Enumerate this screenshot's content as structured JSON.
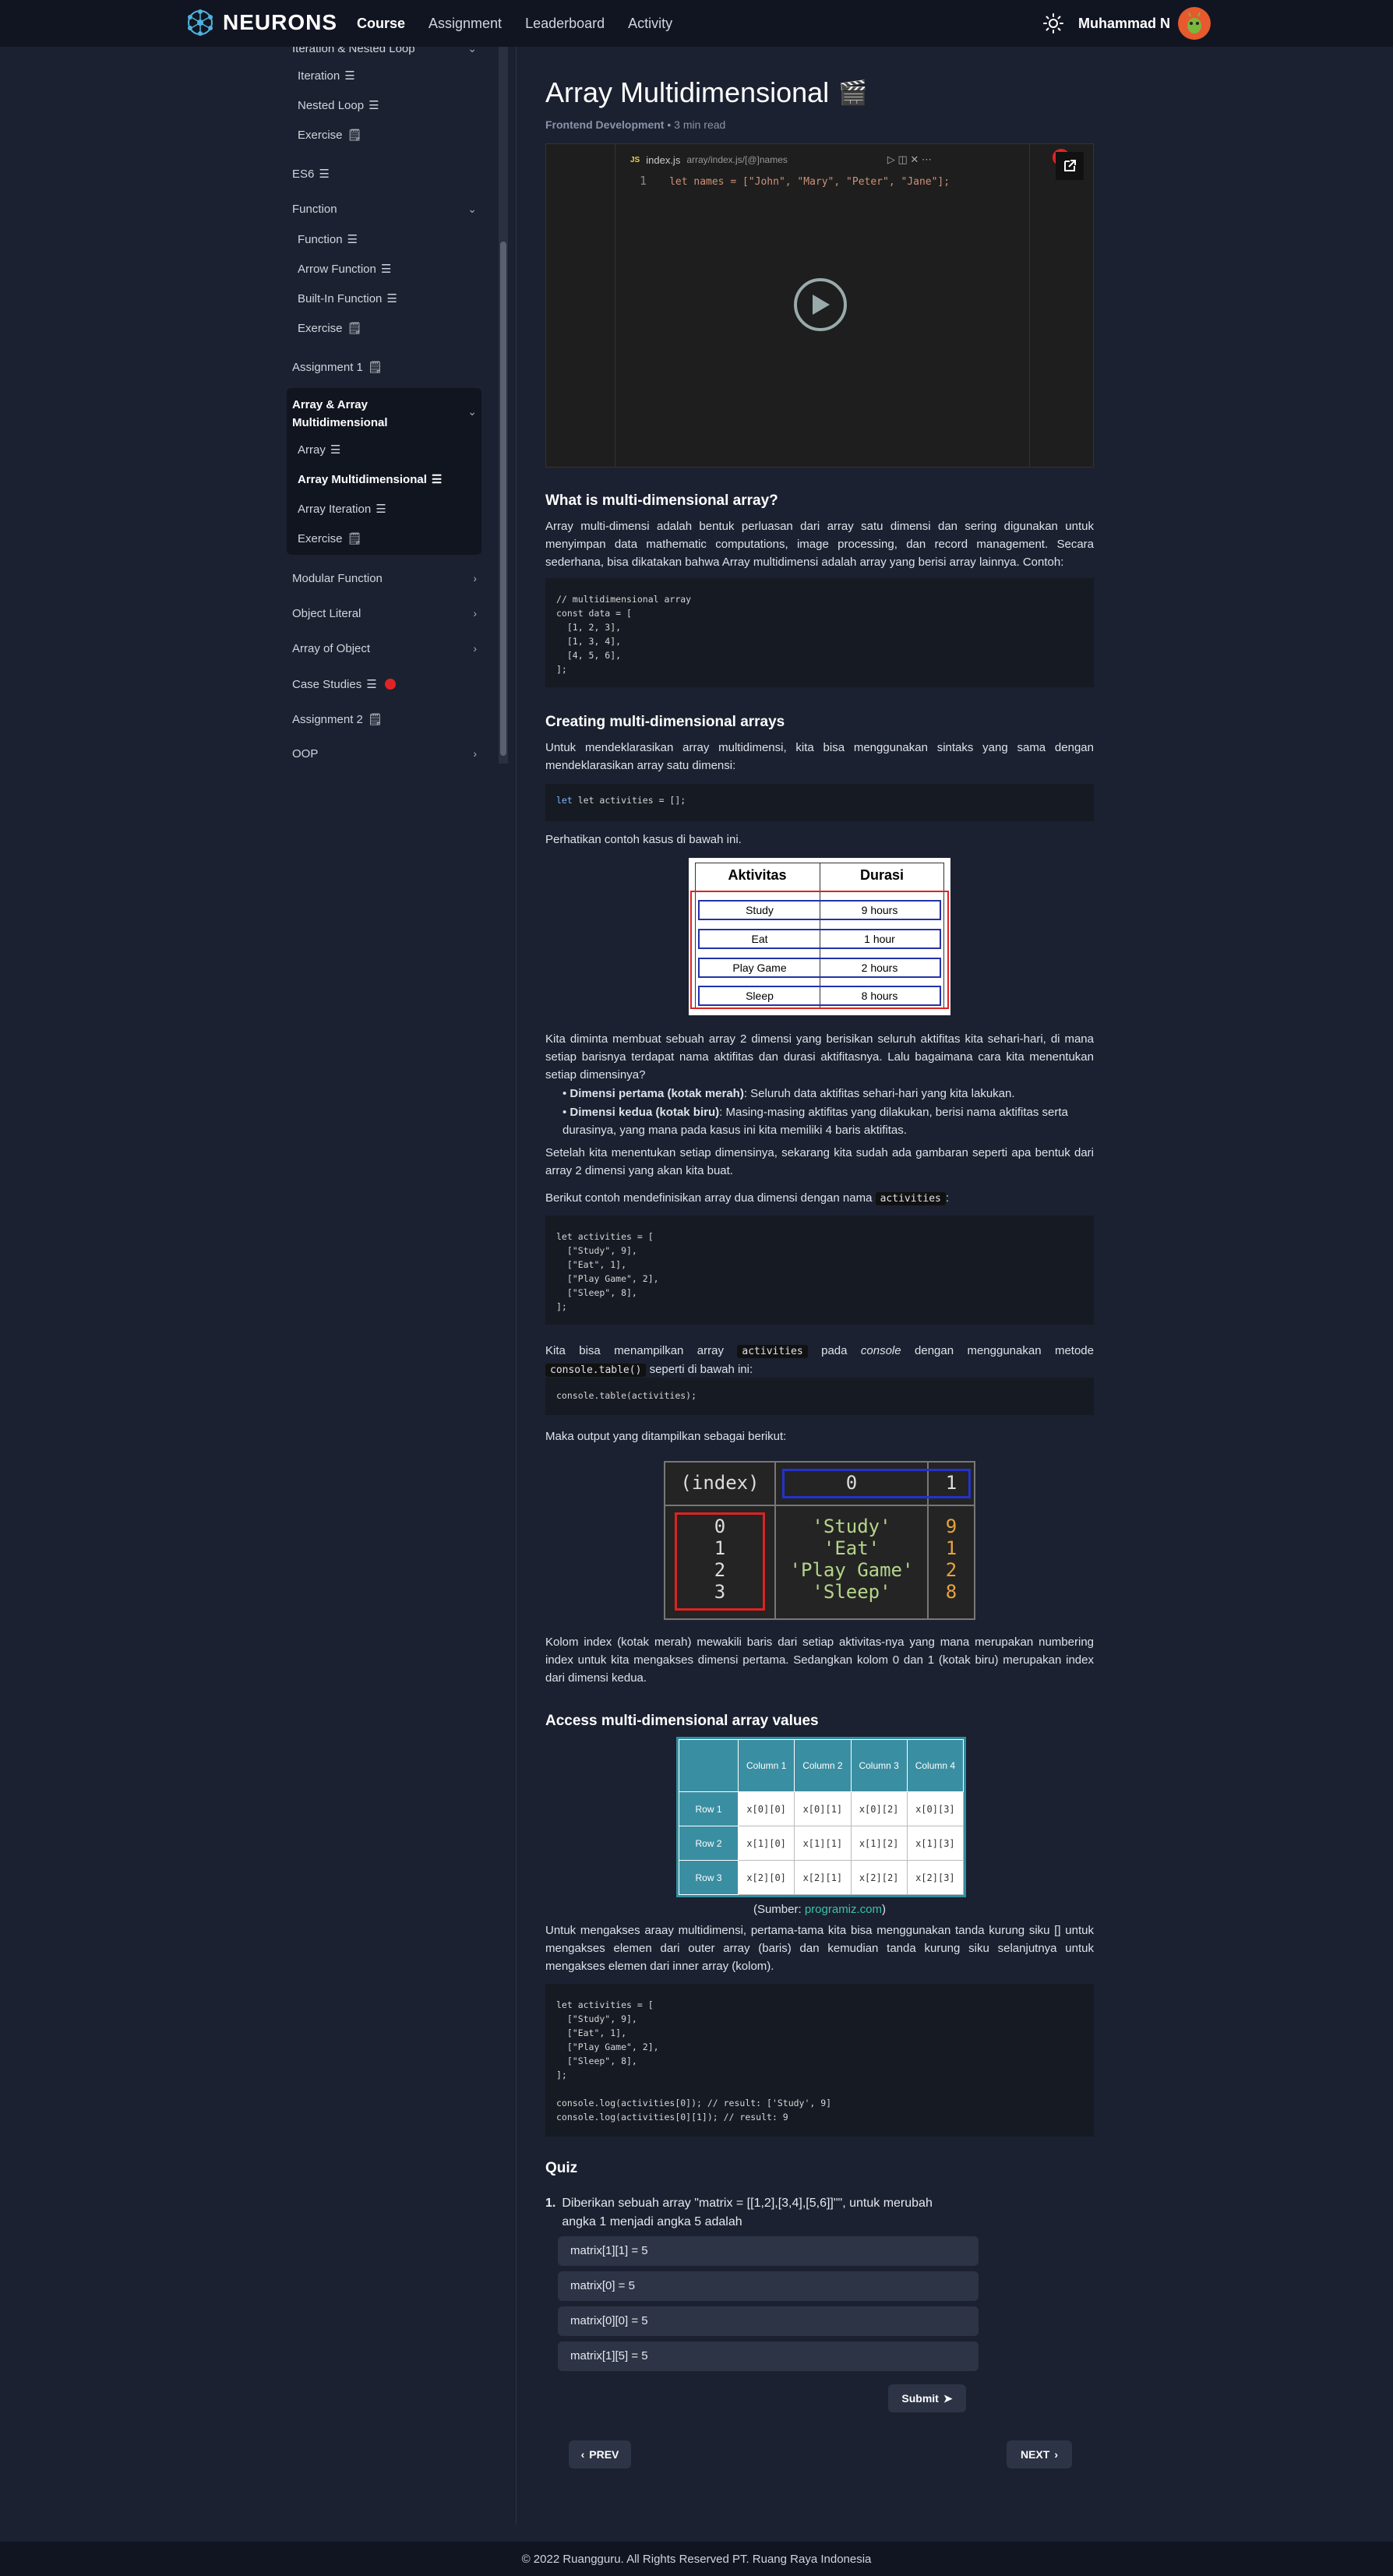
{
  "app": {
    "brand": "NEURONS",
    "user": "Muhammad N"
  },
  "nav": {
    "items": [
      "Course",
      "Assignment",
      "Leaderboard",
      "Activity"
    ],
    "active": "Course"
  },
  "sidebar": {
    "items": [
      {
        "label": "Iteration & Nested Loop",
        "type": "group"
      },
      {
        "label": "Iteration",
        "type": "sub"
      },
      {
        "label": "Nested Loop",
        "type": "sub"
      },
      {
        "label": "Exercise",
        "type": "sub"
      },
      {
        "label": "ES6",
        "type": "item"
      },
      {
        "label": "Function",
        "type": "group"
      },
      {
        "label": "Function",
        "type": "sub"
      },
      {
        "label": "Arrow Function",
        "type": "sub"
      },
      {
        "label": "Built-In Function",
        "type": "sub"
      },
      {
        "label": "Exercise",
        "type": "sub"
      },
      {
        "label": "Assignment 1",
        "type": "item"
      },
      {
        "label": "Array & Array Multidimensional",
        "type": "group"
      },
      {
        "label": "Array",
        "type": "sub"
      },
      {
        "label": "Array Multidimensional",
        "type": "sub-active"
      },
      {
        "label": "Array Iteration",
        "type": "sub"
      },
      {
        "label": "Exercise",
        "type": "sub"
      },
      {
        "label": "Modular Function",
        "type": "group"
      },
      {
        "label": "Object Literal",
        "type": "group"
      },
      {
        "label": "Array of Object",
        "type": "group"
      },
      {
        "label": "Case Studies",
        "type": "item"
      },
      {
        "label": "Assignment 2",
        "type": "item"
      },
      {
        "label": "OOP",
        "type": "group"
      }
    ]
  },
  "article": {
    "title": "Array Multidimensional",
    "category": "Frontend Development",
    "read_time": "3 min read",
    "video": {
      "file_tab": "index.js",
      "path": "array/index.js/[@]names",
      "line_no": "1",
      "code": "let names = [\"John\", \"Mary\", \"Peter\", \"Jane\"];"
    },
    "h1": "What is multi-dimensional array?",
    "p1": "Array multi-dimensi adalah bentuk perluasan dari array satu dimensi dan sering digunakan untuk menyimpan data mathematic computations, image processing, dan record management. Secara sederhana, bisa dikatakan bahwa Array multidimensi adalah array yang berisi array lainnya. Contoh:",
    "code1": "// multidimensional array\nconst data = [\n  [1, 2, 3],\n  [1, 3, 4],\n  [4, 5, 6],\n];",
    "h2": "Creating multi-dimensional arrays",
    "p2": "Untuk mendeklarasikan array multidimensi, kita bisa menggunakan sintaks yang sama dengan mendeklarasikan array satu dimensi:",
    "code2": "let activities = [];",
    "p3": "Perhatikan contoh kasus di bawah ini.",
    "table_img": {
      "headers": [
        "Aktivitas",
        "Durasi"
      ],
      "rows": [
        [
          "Study",
          "9 hours"
        ],
        [
          "Eat",
          "1 hour"
        ],
        [
          "Play Game",
          "2 hours"
        ],
        [
          "Sleep",
          "8 hours"
        ]
      ]
    },
    "p4": "Kita diminta membuat sebuah array 2 dimensi yang berisikan seluruh aktifitas kita sehari-hari, di mana setiap barisnya terdapat nama aktifitas dan durasi aktifitasnya. Lalu bagaimana cara kita menentukan setiap dimensinya?",
    "b1_strong": "Dimensi pertama (kotak merah)",
    "b1_text": ": Seluruh data aktifitas sehari-hari yang kita lakukan.",
    "b2_strong": "Dimensi kedua (kotak biru)",
    "b2_text": ": Masing-masing aktifitas yang dilakukan, berisi nama aktifitas serta durasinya, yang mana pada kasus ini kita memiliki 4 baris aktifitas.",
    "p5": "Setelah kita menentukan setiap dimensinya, sekarang kita sudah ada gambaran seperti apa bentuk dari array 2 dimensi yang akan kita buat.",
    "p6_pre": "Berikut contoh mendefinisikan array dua dimensi dengan nama ",
    "p6_code": "activities",
    "p6_post": ":",
    "code3": "let activities = [\n  [\"Study\", 9],\n  [\"Eat\", 1],\n  [\"Play Game\", 2],\n  [\"Sleep\", 8],\n];",
    "p7_a": "Kita bisa menampilkan array ",
    "p7_code1": "activities",
    "p7_b": " pada ",
    "p7_em": "console",
    "p7_c": " dengan menggunakan metode ",
    "p7_code2": "console.table()",
    "p7_d": " seperti di bawah ini:",
    "code4": "console.table(activities);",
    "p8": "Maka output yang ditampilkan sebagai berikut:",
    "console_img": {
      "headers": [
        "(index)",
        "0",
        "1"
      ],
      "index": [
        "0",
        "1",
        "2",
        "3"
      ],
      "col0": [
        "'Study'",
        "'Eat'",
        "'Play Game'",
        "'Sleep'"
      ],
      "col1": [
        "9",
        "1",
        "2",
        "8"
      ]
    },
    "p9": "Kolom index (kotak merah) mewakili baris dari setiap aktivitas-nya yang mana merupakan numbering index untuk kita mengakses dimensi pertama. Sedangkan kolom 0 dan 1 (kotak biru) merupakan index dari dimensi kedua.",
    "h3": "Access multi-dimensional array values",
    "prog_img": {
      "col_headers": [
        "Column 1",
        "Column 2",
        "Column 3",
        "Column 4"
      ],
      "row_headers": [
        "Row 1",
        "Row 2",
        "Row 3"
      ],
      "cells": [
        [
          "x[0][0]",
          "x[0][1]",
          "x[0][2]",
          "x[0][3]"
        ],
        [
          "x[1][0]",
          "x[1][1]",
          "x[1][2]",
          "x[1][3]"
        ],
        [
          "x[2][0]",
          "x[2][1]",
          "x[2][2]",
          "x[2][3]"
        ]
      ]
    },
    "source_pre": "(Sumber: ",
    "source_link": "programiz.com",
    "source_post": ")",
    "p10": "Untuk mengakses araay multidimensi, pertama-tama kita bisa menggunakan tanda kurung siku [] untuk mengakses elemen dari outer array (baris) dan kemudian tanda kurung siku selanjutnya untuk mengakses elemen dari inner array (kolom).",
    "code5": "let activities = [\n  [\"Study\", 9],\n  [\"Eat\", 1],\n  [\"Play Game\", 2],\n  [\"Sleep\", 8],\n];\n\nconsole.log(activities[0]); // result: ['Study', 9]\nconsole.log(activities[0][1]); // result: 9"
  },
  "quiz": {
    "title": "Quiz",
    "number": "1.",
    "question": "Diberikan sebuah array \"matrix = [[1,2],[3,4],[5,6]]\"\", untuk merubah angka 1 menjadi angka 5 adalah",
    "options": [
      "matrix[1][1] = 5",
      "matrix[0] = 5",
      "matrix[0][0] = 5",
      "matrix[1][5] = 5"
    ],
    "submit": "Submit"
  },
  "pager": {
    "prev": "PREV",
    "next": "NEXT"
  },
  "footer": "© 2022 Ruangguru. All Rights Reserved PT. Ruang Raya Indonesia"
}
